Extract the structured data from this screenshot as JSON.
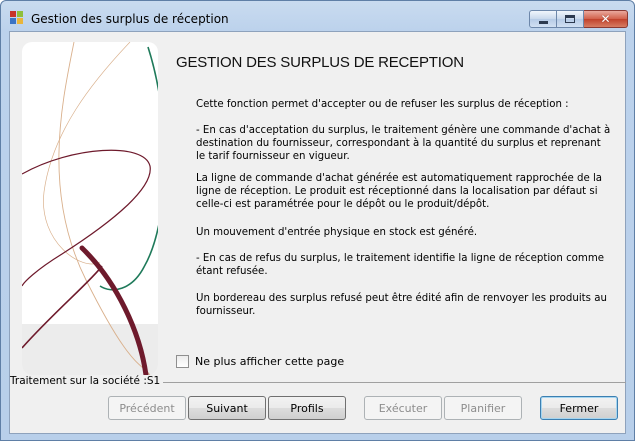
{
  "window": {
    "title": "Gestion des surplus de réception",
    "close_glyph": "✕"
  },
  "main": {
    "heading": "GESTION DES SURPLUS DE RECEPTION",
    "paragraphs": [
      "Cette fonction permet d'accepter ou de refuser les surplus de réception :",
      "- En cas d'acceptation du surplus, le traitement génère une commande d'achat à destination du fournisseur, correspondant à la quantité du surplus et reprenant le tarif fournisseur en vigueur.",
      "La ligne de commande d'achat générée est automatiquement rapprochée de la ligne de réception. Le produit est réceptionné dans la localisation par défaut si celle-ci est paramétrée pour le dépôt ou le produit/dépôt.",
      "Un mouvement d'entrée physique en stock est généré.",
      "- En cas de refus du surplus, le traitement identifie la ligne de réception comme étant refusée.",
      "Un bordereau des surplus refusé peut être édité afin de renvoyer les produits au fournisseur."
    ],
    "checkbox_label": "Ne plus afficher cette page",
    "checkbox_checked": false,
    "company_label": "Traitement sur la société :S1"
  },
  "buttons": {
    "previous": "Précédent",
    "next": "Suivant",
    "profiles": "Profils",
    "execute": "Exécuter",
    "schedule": "Planifier",
    "close": "Fermer"
  },
  "colors": {
    "curve_dark_red": "#6e1a2c",
    "curve_green": "#1f7a5a",
    "curve_tan": "#d9b08c"
  }
}
